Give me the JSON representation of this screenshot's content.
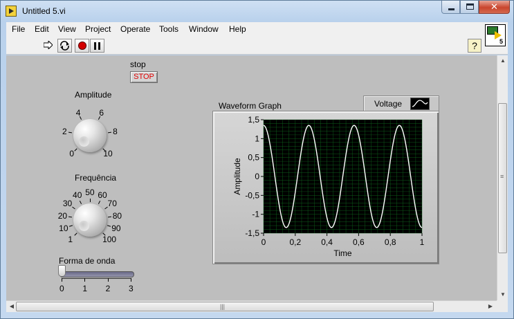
{
  "window": {
    "title": "Untitled 5.vi",
    "close_glyph": "✕"
  },
  "menu": [
    "File",
    "Edit",
    "View",
    "Project",
    "Operate",
    "Tools",
    "Window",
    "Help"
  ],
  "toolbar": {
    "icons": [
      "run-arrow-icon",
      "run-continuously-icon",
      "abort-icon",
      "pause-icon"
    ],
    "help_label": "?",
    "vi_icon_number": "5"
  },
  "front_panel": {
    "stop": {
      "label": "stop",
      "button_text": "STOP"
    },
    "amplitude": {
      "label": "Amplitude",
      "scale": [
        "0",
        "2",
        "4",
        "6",
        "8",
        "10"
      ],
      "value": 0
    },
    "frequencia": {
      "label": "Frequência",
      "scale": [
        "1",
        "10",
        "20",
        "30",
        "40",
        "50",
        "60",
        "70",
        "80",
        "90",
        "100"
      ],
      "value": 1
    },
    "forma_de_onda": {
      "label": "Forma de onda",
      "scale": [
        "0",
        "1",
        "2",
        "3"
      ],
      "value": 0
    },
    "graph": {
      "label": "Waveform Graph",
      "legend_label": "Voltage",
      "plot_bg": "#000000",
      "grid_color": "#0f6a1f",
      "trace_color": "#ffffff"
    }
  },
  "chart_data": {
    "type": "line",
    "title": "Waveform Graph",
    "xlabel": "Time",
    "ylabel": "Amplitude",
    "xlim": [
      0,
      1
    ],
    "ylim": [
      -1.5,
      1.5
    ],
    "x_ticks": [
      "0",
      "0,2",
      "0,4",
      "0,6",
      "0,8",
      "1"
    ],
    "y_ticks": [
      "1,5",
      "1",
      "0,5",
      "0",
      "-0,5",
      "-1",
      "-1,5"
    ],
    "grid": true,
    "legend": "top-right",
    "series": [
      {
        "name": "Voltage",
        "waveform": "sine",
        "amplitude": 1.35,
        "frequency_cycles": 3.5,
        "phase_deg": 90,
        "offset": 0
      }
    ]
  },
  "scrollbars": {
    "up": "▲",
    "down": "▼",
    "left": "◀",
    "right": "▶",
    "grip_v": "≡",
    "grip_h": "|||"
  }
}
